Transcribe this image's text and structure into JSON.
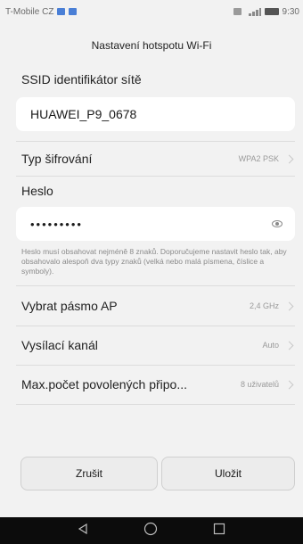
{
  "status_bar": {
    "carrier": "T-Mobile CZ",
    "time": "9:30"
  },
  "page": {
    "title": "Nastavení hotspotu Wi-Fi"
  },
  "ssid": {
    "label": "SSID identifikátor sítě",
    "value": "HUAWEI_P9_0678"
  },
  "encryption": {
    "label": "Typ šifrování",
    "value": "WPA2 PSK"
  },
  "password": {
    "label": "Heslo",
    "value": "•••••••••",
    "hint": "Heslo musí obsahovat nejméně 8 znaků. Doporučujeme nastavit heslo tak, aby obsahovalo alespoň dva typy znaků (velká nebo malá písmena, číslice a symboly)."
  },
  "band": {
    "label": "Vybrat pásmo AP",
    "value": "2,4 GHz"
  },
  "channel": {
    "label": "Vysílací kanál",
    "value": "Auto"
  },
  "max_connections": {
    "label": "Max.počet povolených připo...",
    "value": "8 uživatelů"
  },
  "buttons": {
    "cancel": "Zrušit",
    "save": "Uložit"
  },
  "colors": {
    "background": "#f2f2f2",
    "field_bg": "#ffffff",
    "navbar": "#0c0c0c"
  }
}
